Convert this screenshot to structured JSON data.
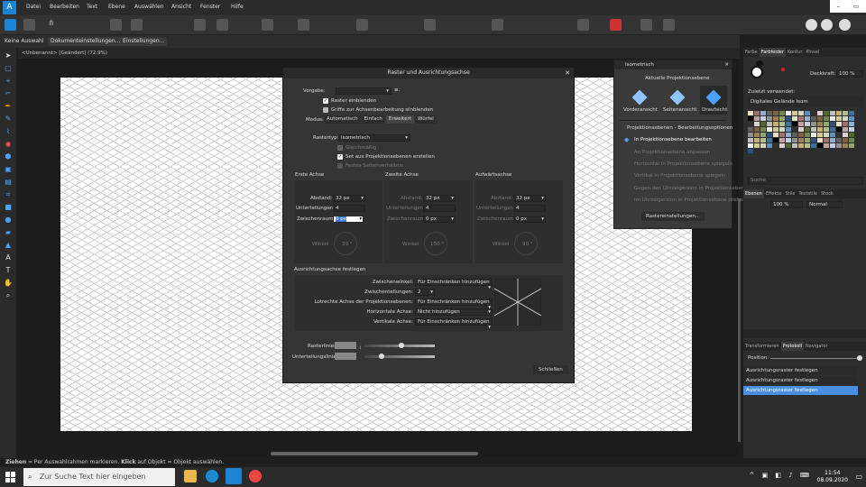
{
  "menubar": {
    "items": [
      "Datei",
      "Bearbeiten",
      "Text",
      "Ebene",
      "Auswählen",
      "Ansicht",
      "Fenster",
      "Hilfe"
    ]
  },
  "context_bar": {
    "buttons": [
      "Keine Auswahl",
      "Dokumenteinstellungen...",
      "Einstellungen..."
    ]
  },
  "document": {
    "tab": "<Unbenannt> [Geändert] (72.9%)"
  },
  "dialog": {
    "title": "Raster und Ausrichtungsachse",
    "preset_label": "Vorgabe:",
    "show_grid": "Raster einblenden",
    "handles": "Griffe zur Achsenbearbeitung einblenden",
    "mode_label": "Modus:",
    "modes": [
      "Automatisch",
      "Einfach",
      "Erweitert",
      "Würfel"
    ],
    "gridtype_label": "Rastertyp:",
    "gridtype_value": "Isometrisch",
    "uniform": "Gleichmäßig",
    "set_planes": "Set aus Projektionsebenen erstellen",
    "fixed_ratio": "Festes Seitenverhältnis",
    "axis1": {
      "title": "Erste Achse",
      "spacing_label": "Abstand:",
      "spacing": "32 px",
      "div_label": "Unterteilungen:",
      "div": "4",
      "gutter_label": "Zwischenraum:",
      "gutter": "0 px",
      "angle_label": "Winkel",
      "angle": "30 °"
    },
    "axis2": {
      "title": "Zweite Achse",
      "spacing_label": "Abstand:",
      "spacing": "32 px",
      "div_label": "Unterteilungen:",
      "div": "4",
      "gutter_label": "Zwischenraum:",
      "gutter": "0 px",
      "angle_label": "Winkel",
      "angle": "150 °"
    },
    "axis3": {
      "title": "Aufwärtsachse",
      "spacing_label": "Abstand:",
      "spacing": "32 px",
      "div_label": "Unterteilungen:",
      "div": "4",
      "gutter_label": "Zwischenraum:",
      "gutter": "0 px",
      "angle_label": "Winkel",
      "angle": "90 °"
    },
    "align_title": "Ausrichtungsachse festlegen",
    "align_rows": [
      {
        "label": "Zwischenwinkel:",
        "value": "Für Einschränken hinzufügen"
      },
      {
        "label": "Zwischenteilungen:",
        "value": "2"
      },
      {
        "label": "Lotrechte Achse der Projektionsebenen:",
        "value": "Für Einschränken hinzufügen"
      },
      {
        "label": "Horizontale Achse:",
        "value": "Nicht hinzufügen"
      },
      {
        "label": "Vertikale Achse:",
        "value": "Für Einschränken hinzufügen"
      }
    ],
    "gridlines_label": "Rasterlinien:",
    "subdiv_lines_label": "Unterteilungslinien:",
    "close": "Schließen"
  },
  "iso_panel": {
    "tab": "Isometrisch",
    "current": "Aktuelle Projektionsebene",
    "planes": [
      "Vorderansicht",
      "Seitenansicht",
      "Draufsicht"
    ],
    "options_title": "Projektionsebenen - Bearbeitungsoptionen",
    "options": [
      "In Projektionsebene bearbeiten",
      "An Projektionsebene anpassen",
      "Horizontal in Projektionsebene spiegeln",
      "Vertikal in Projektionsebene spiegeln",
      "Gegen den Uhrzeigersinn in Projektionsebene drehen",
      "Im Uhrzeigersinn in Projektionsebene drehen"
    ],
    "button": "Rastereinstellungen..."
  },
  "right_panel": {
    "tabs1": [
      "Farbe",
      "Farbfelder",
      "Kontur",
      "Pinsel"
    ],
    "opacity_label": "Deckkraft:",
    "opacity": "100 %",
    "recent": "Zuletzt verwendet:",
    "palette": "Digitales Gelände Isom",
    "search": "Suche",
    "tabs2": [
      "Ebenen",
      "Effekte",
      "Stile",
      "Textstile",
      "Stock"
    ],
    "layer_opacity": "100 %",
    "blend": "Normal",
    "tabs3": [
      "Transformieren",
      "Protokoll",
      "Navigator"
    ],
    "position": "Position:",
    "history": [
      "Ausrichtungsraster festlegen",
      "Ausrichtungsraster festlegen",
      "Ausrichtungsraster festlegen"
    ]
  },
  "status": {
    "bold1": "Ziehen",
    "t1": " = Per Auswahlrahmen markieren. ",
    "bold2": "Klick",
    "t2": " auf Objekt = Objekt auswählen."
  },
  "taskbar": {
    "search": "Zur Suche Text hier eingeben",
    "time": "11:54",
    "date": "08.09.2020"
  }
}
